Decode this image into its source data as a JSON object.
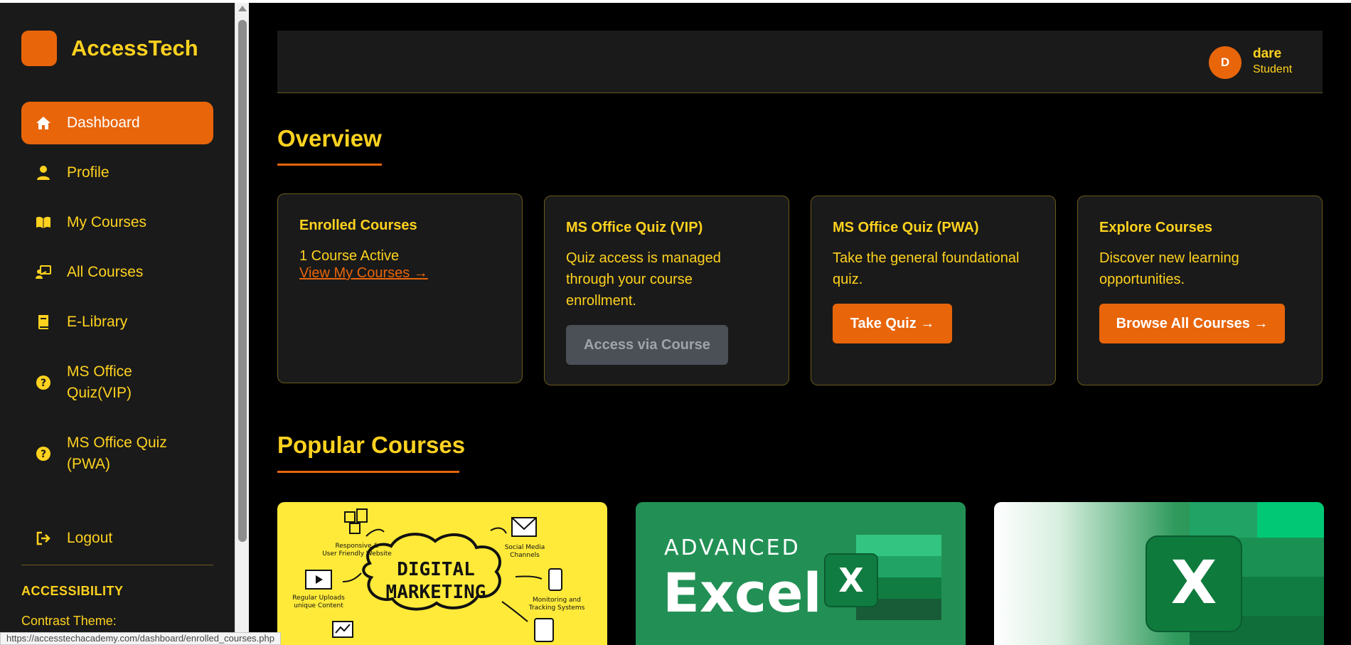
{
  "brand": {
    "name": "AccessTech",
    "accent": "#e8650a",
    "text_color": "#ffd21f"
  },
  "sidebar": {
    "items": [
      {
        "label": "Dashboard",
        "icon": "home-icon",
        "active": true
      },
      {
        "label": "Profile",
        "icon": "user-icon"
      },
      {
        "label": "My Courses",
        "icon": "book-open-icon"
      },
      {
        "label": "All Courses",
        "icon": "teacher-board-icon"
      },
      {
        "label": "E-Library",
        "icon": "book-icon"
      },
      {
        "label": "MS Office Quiz(VIP)",
        "icon": "question-circle-icon"
      },
      {
        "label": "MS Office Quiz (PWA)",
        "icon": "question-circle-icon"
      },
      {
        "label": "Logout",
        "icon": "logout-icon"
      }
    ],
    "accessibility_title": "ACCESSIBILITY",
    "contrast_label": "Contrast Theme:"
  },
  "header": {
    "avatar_initial": "D",
    "user_name": "dare",
    "user_role": "Student"
  },
  "overview": {
    "title": "Overview",
    "cards": [
      {
        "title": "Enrolled Courses",
        "text": "1 Course Active",
        "link": "View My Courses →"
      },
      {
        "title": "MS Office Quiz (VIP)",
        "text": "Quiz access is managed through your course enrollment.",
        "button": "Access via Course"
      },
      {
        "title": "MS Office Quiz (PWA)",
        "text": "Take the general foundational quiz.",
        "button": "Take Quiz →"
      },
      {
        "title": "Explore Courses",
        "text": "Discover new learning opportunities.",
        "button": "Browse All Courses →"
      }
    ]
  },
  "popular": {
    "title": "Popular Courses",
    "courses": [
      {
        "image_text_line1": "DIGITAL",
        "image_text_line2": "MARKETING",
        "labels": [
          "Responsive &",
          "User Friendly Website",
          "Social Media",
          "Channels",
          "Regular Uploads",
          "unique Content",
          "Monitoring and",
          "Tracking Systems"
        ]
      },
      {
        "image_text_line1": "ADVANCED",
        "image_text_line2": "Excel",
        "logo_letter": "X"
      },
      {
        "logo_letter": "X"
      }
    ]
  },
  "status_bar": {
    "url": "https://accesstechacademy.com/dashboard/enrolled_courses.php"
  }
}
